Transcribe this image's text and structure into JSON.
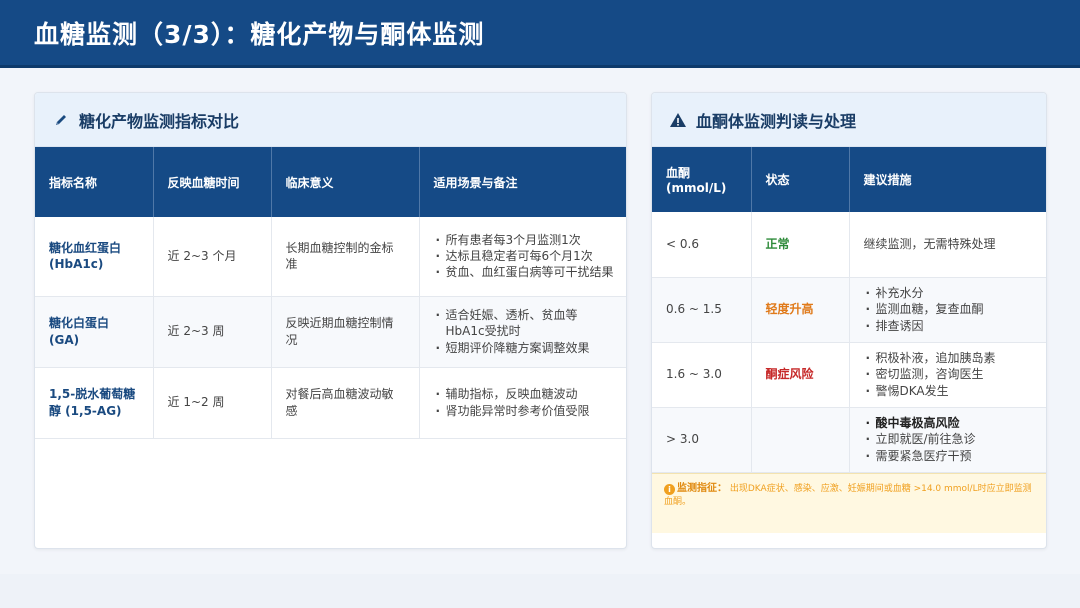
{
  "header": {
    "title": "血糖监测（3/3）：糖化产物与酮体监测"
  },
  "left": {
    "title": "糖化产物监测指标对比",
    "icon": "pen-icon",
    "columns": [
      "指标名称",
      "反映血糖时间",
      "临床意义",
      "适用场景与备注"
    ],
    "rows": [
      {
        "name": "糖化血红蛋白 (HbA1c)",
        "time": "近 2~3 个月",
        "meaning": "长期血糖控制的金标准",
        "notes": [
          "所有患者每3个月监测1次",
          "达标且稳定者可每6个月1次",
          "贫血、血红蛋白病等可干扰结果"
        ]
      },
      {
        "name": "糖化白蛋白 (GA)",
        "time": "近 2~3 周",
        "meaning": "反映近期血糖控制情况",
        "notes": [
          "适合妊娠、透析、贫血等HbA1c受扰时",
          "短期评价降糖方案调整效果"
        ]
      },
      {
        "name": "1,5-脱水葡萄糖醇 (1,5-AG)",
        "time": "近 1~2 周",
        "meaning": "对餐后高血糖波动敏感",
        "notes": [
          "辅助指标，反映血糖波动",
          "肾功能异常时参考价值受限"
        ]
      }
    ]
  },
  "right": {
    "title": "血酮体监测判读与处理",
    "icon": "warning-icon",
    "columns": [
      "血酮 (mmol/L)",
      "状态",
      "建议措施"
    ],
    "rows": [
      {
        "range": "< 0.6",
        "status": "正常",
        "status_color": "#2e8b3a",
        "actions": [
          "继续监测，无需特殊处理"
        ],
        "plain": true
      },
      {
        "range": "0.6 ~ 1.5",
        "status": "轻度升高",
        "status_color": "#e07a1a",
        "actions": [
          "补充水分",
          "监测血糖，复查血酮",
          "排查诱因"
        ]
      },
      {
        "range": "1.6 ~ 3.0",
        "status": "酮症风险",
        "status_color": "#c62828",
        "actions": [
          "积极补液，追加胰岛素",
          "密切监测，咨询医生",
          "警惕DKA发生"
        ]
      },
      {
        "range": "> 3.0",
        "status": "",
        "actions_strong": "酸中毒极高风险",
        "actions": [
          "立即就医/前往急诊",
          "需要紧急医疗干预"
        ]
      }
    ],
    "note": {
      "label": "监测指征：",
      "text": "出现DKA症状、感染、应激、妊娠期间或血糖 >14.0 mmol/L时应立即监测血酮。"
    }
  }
}
